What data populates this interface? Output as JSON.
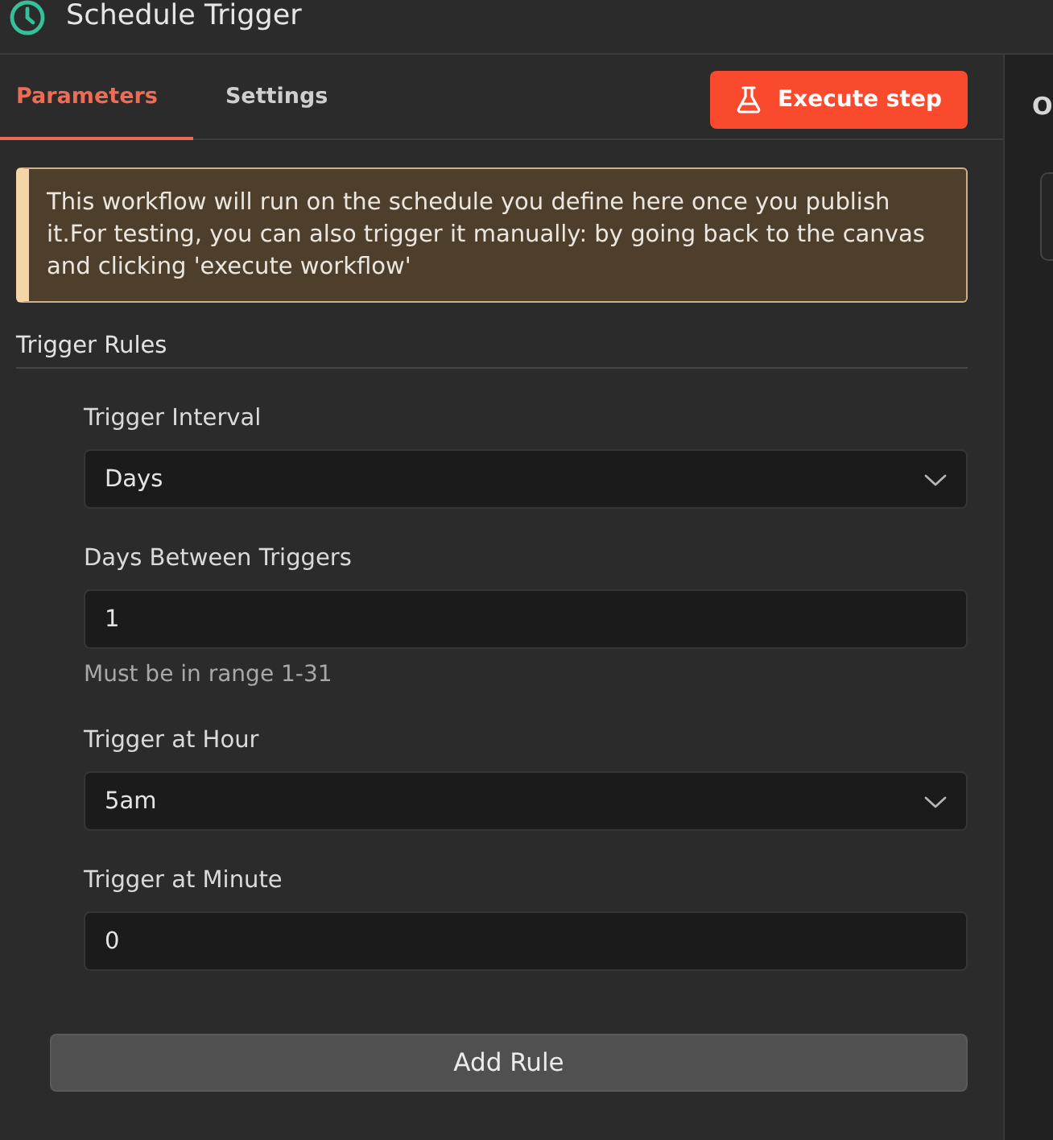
{
  "header": {
    "title": "Schedule Trigger"
  },
  "tabs": [
    {
      "label": "Parameters",
      "selected": true
    },
    {
      "label": "Settings",
      "selected": false
    }
  ],
  "execute_button": {
    "label": "Execute step"
  },
  "notice": {
    "text": "This workflow will run on the schedule you define here once you publish it.For testing, you can also trigger it manually: by going back to the canvas and clicking 'execute workflow'"
  },
  "section": {
    "title": "Trigger Rules"
  },
  "fields": [
    {
      "kind": "select",
      "label": "Trigger Interval",
      "value": "Days"
    },
    {
      "kind": "input",
      "label": "Days Between Triggers",
      "value": "1",
      "hint": "Must be in range 1-31"
    },
    {
      "kind": "select",
      "label": "Trigger at Hour",
      "value": "5am"
    },
    {
      "kind": "input",
      "label": "Trigger at Minute",
      "value": "0"
    }
  ],
  "add_button": {
    "label": "Add Rule"
  },
  "side_panel": {
    "title": "O"
  }
}
